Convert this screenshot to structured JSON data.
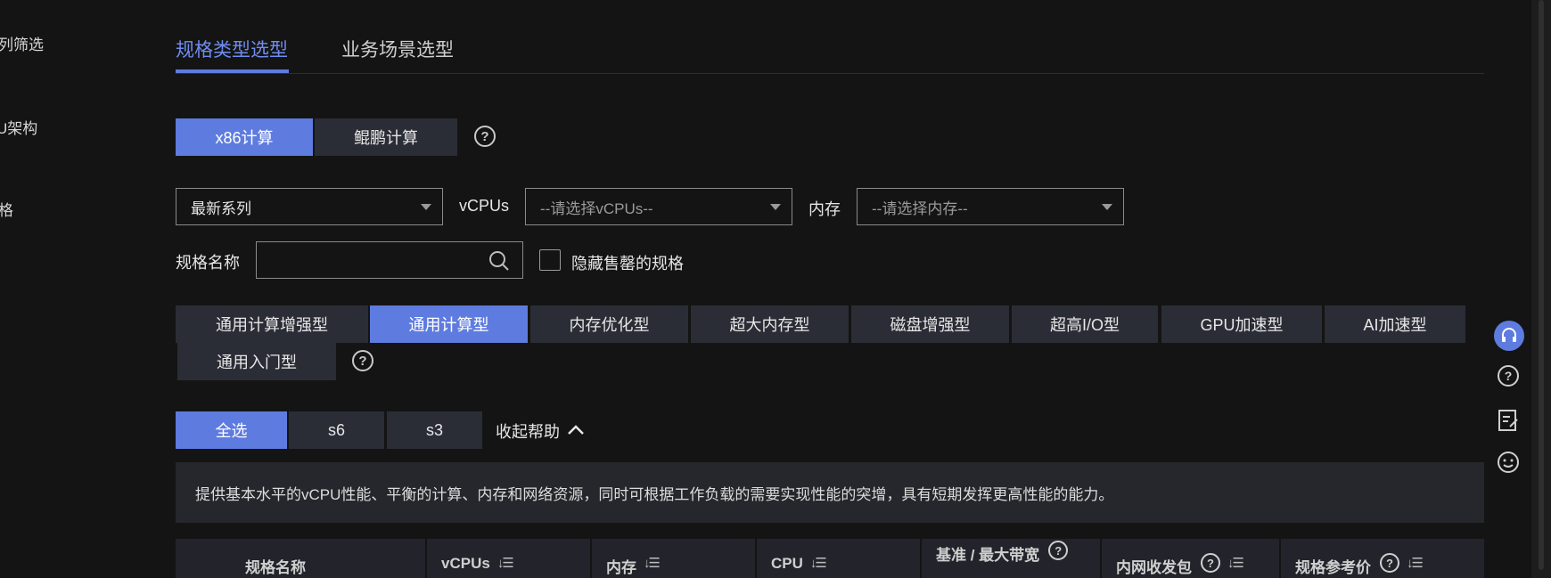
{
  "left_labels": {
    "filter": "列筛选",
    "arch": "U架构",
    "spec": "格"
  },
  "tabs": [
    {
      "label": "规格类型选型",
      "active": true
    },
    {
      "label": "业务场景选型",
      "active": false
    }
  ],
  "arch_buttons": [
    {
      "label": "x86计算",
      "selected": true
    },
    {
      "label": "鲲鹏计算",
      "selected": false
    }
  ],
  "filters": {
    "series_value": "最新系列",
    "vcpus_label": "vCPUs",
    "vcpus_placeholder": "--请选择vCPUs--",
    "memory_label": "内存",
    "memory_placeholder": "--请选择内存--",
    "spec_name_label": "规格名称",
    "spec_name_value": "",
    "hide_soldout_label": "隐藏售罄的规格"
  },
  "type_tabs": [
    {
      "label": "通用计算增强型",
      "selected": false
    },
    {
      "label": "通用计算型",
      "selected": true
    },
    {
      "label": "内存优化型",
      "selected": false
    },
    {
      "label": "超大内存型",
      "selected": false
    },
    {
      "label": "磁盘增强型",
      "selected": false
    },
    {
      "label": "超高I/O型",
      "selected": false
    },
    {
      "label": "GPU加速型",
      "selected": false
    },
    {
      "label": "AI加速型",
      "selected": false
    },
    {
      "label": "通用入门型",
      "selected": false
    }
  ],
  "series_buttons": [
    {
      "label": "全选",
      "selected": true
    },
    {
      "label": "s6",
      "selected": false
    },
    {
      "label": "s3",
      "selected": false
    }
  ],
  "collapse_help": "收起帮助",
  "help_text": "提供基本水平的vCPU性能、平衡的计算、内存和网络资源，同时可根据工作负载的需要实现性能的突增，具有短期发挥更高性能的能力。",
  "table_headers": [
    {
      "label": "规格名称"
    },
    {
      "label": "vCPUs"
    },
    {
      "label": "内存"
    },
    {
      "label": "CPU"
    },
    {
      "label": "基准 / 最大带宽"
    },
    {
      "label": "内网收发包"
    },
    {
      "label": "规格参考价"
    }
  ],
  "colors": {
    "accent": "#5e7ce0",
    "background": "#141414",
    "panel": "#26272d",
    "button": "#2b2d36"
  },
  "icons": {
    "help": "?",
    "caret": "chevron-down",
    "collapse": "chevron-up"
  }
}
